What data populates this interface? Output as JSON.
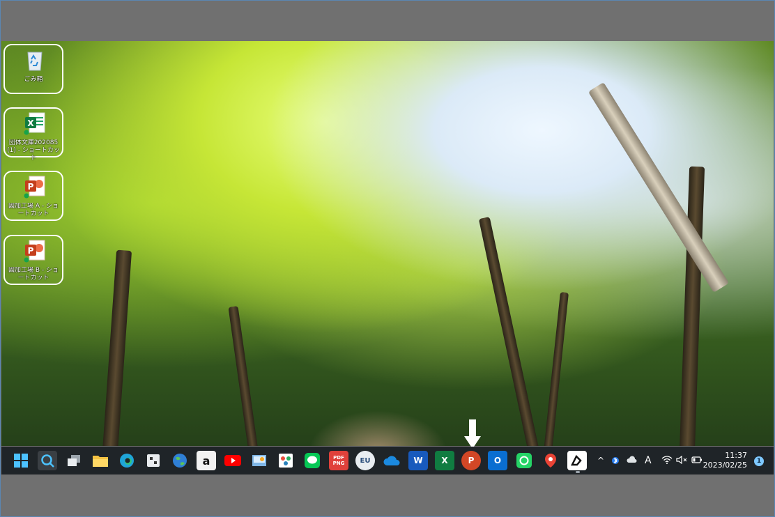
{
  "desktop": {
    "icons": [
      {
        "label": "ごみ箱",
        "icon": "recycle-bin-icon"
      },
      {
        "label": "団体文庫202085 (1) - ショートカット",
        "icon": "excel-file-icon"
      },
      {
        "label": "図加工場 A - ショートカット",
        "icon": "powerpoint-file-icon"
      },
      {
        "label": "図加工場 B - ショートカット",
        "icon": "powerpoint-file-icon"
      }
    ]
  },
  "taskbar": {
    "apps": [
      {
        "name": "start",
        "icon": "windows-start-icon"
      },
      {
        "name": "search",
        "icon": "search-icon"
      },
      {
        "name": "task-view",
        "icon": "task-view-icon"
      },
      {
        "name": "file-explorer",
        "icon": "folder-icon"
      },
      {
        "name": "edge",
        "icon": "edge-browser-icon"
      },
      {
        "name": "app-1",
        "icon": "dice-app-icon"
      },
      {
        "name": "earth",
        "icon": "globe-icon"
      },
      {
        "name": "amazon",
        "icon": "amazon-icon",
        "text": "a"
      },
      {
        "name": "youtube",
        "icon": "youtube-icon"
      },
      {
        "name": "control-panel",
        "icon": "control-panel-icon"
      },
      {
        "name": "paint",
        "icon": "paint-icon"
      },
      {
        "name": "line",
        "icon": "line-chat-icon"
      },
      {
        "name": "pdf-png",
        "icon": "pdf-png-icon",
        "text": "PDF PNG"
      },
      {
        "name": "eu",
        "icon": "eu-app-icon",
        "text": "EU"
      },
      {
        "name": "onedrive",
        "icon": "onedrive-icon"
      },
      {
        "name": "word",
        "icon": "word-icon",
        "text": "W"
      },
      {
        "name": "excel",
        "icon": "excel-icon",
        "text": "X"
      },
      {
        "name": "powerpoint",
        "icon": "powerpoint-icon",
        "text": "P"
      },
      {
        "name": "outlook",
        "icon": "outlook-icon",
        "text": "O"
      },
      {
        "name": "whatsapp",
        "icon": "phone-chat-icon"
      },
      {
        "name": "maps",
        "icon": "map-pin-icon"
      },
      {
        "name": "pen-app",
        "icon": "pen-app-icon"
      }
    ],
    "tray": {
      "chevron": "^",
      "ime": "A",
      "time": "11:37",
      "date": "2023/02/25",
      "notifications": "1"
    }
  }
}
